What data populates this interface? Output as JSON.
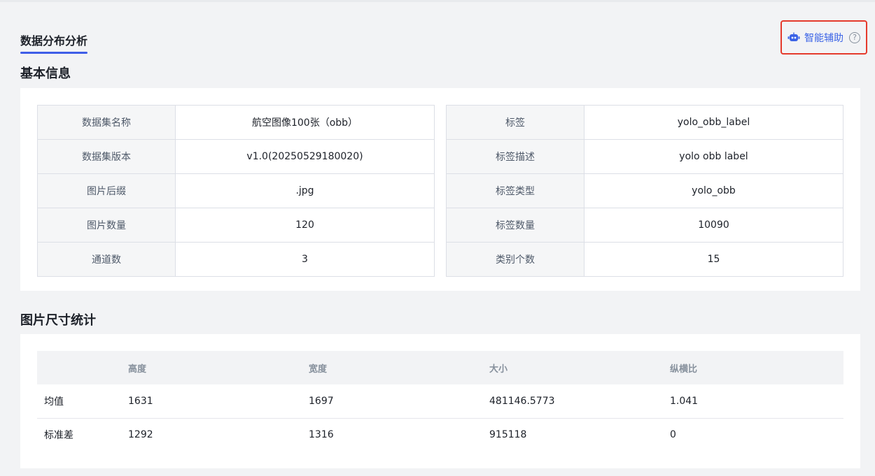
{
  "page": {
    "tab_label": "数据分布分析",
    "assist_label": "智能辅助",
    "help_glyph": "?"
  },
  "basic_info": {
    "title": "基本信息",
    "left": [
      {
        "key": "数据集名称",
        "value": "航空图像100张（obb）"
      },
      {
        "key": "数据集版本",
        "value": "v1.0(20250529180020)"
      },
      {
        "key": "图片后缀",
        "value": ".jpg"
      },
      {
        "key": "图片数量",
        "value": "120"
      },
      {
        "key": "通道数",
        "value": "3"
      }
    ],
    "right": [
      {
        "key": "标签",
        "value": "yolo_obb_label"
      },
      {
        "key": "标签描述",
        "value": "yolo obb label"
      },
      {
        "key": "标签类型",
        "value": "yolo_obb"
      },
      {
        "key": "标签数量",
        "value": "10090"
      },
      {
        "key": "类别个数",
        "value": "15"
      }
    ]
  },
  "size_stats": {
    "title": "图片尺寸统计",
    "headers": [
      "",
      "高度",
      "宽度",
      "大小",
      "纵横比"
    ],
    "rows": [
      [
        "均值",
        "1631",
        "1697",
        "481146.5773",
        "1.041"
      ],
      [
        "标准差",
        "1292",
        "1316",
        "915118",
        "0"
      ]
    ]
  },
  "colors": {
    "accent": "#3b63e6",
    "highlight_border": "#e53a2c"
  },
  "icons": {
    "assist": "robot-icon",
    "help": "help-circle-icon"
  }
}
